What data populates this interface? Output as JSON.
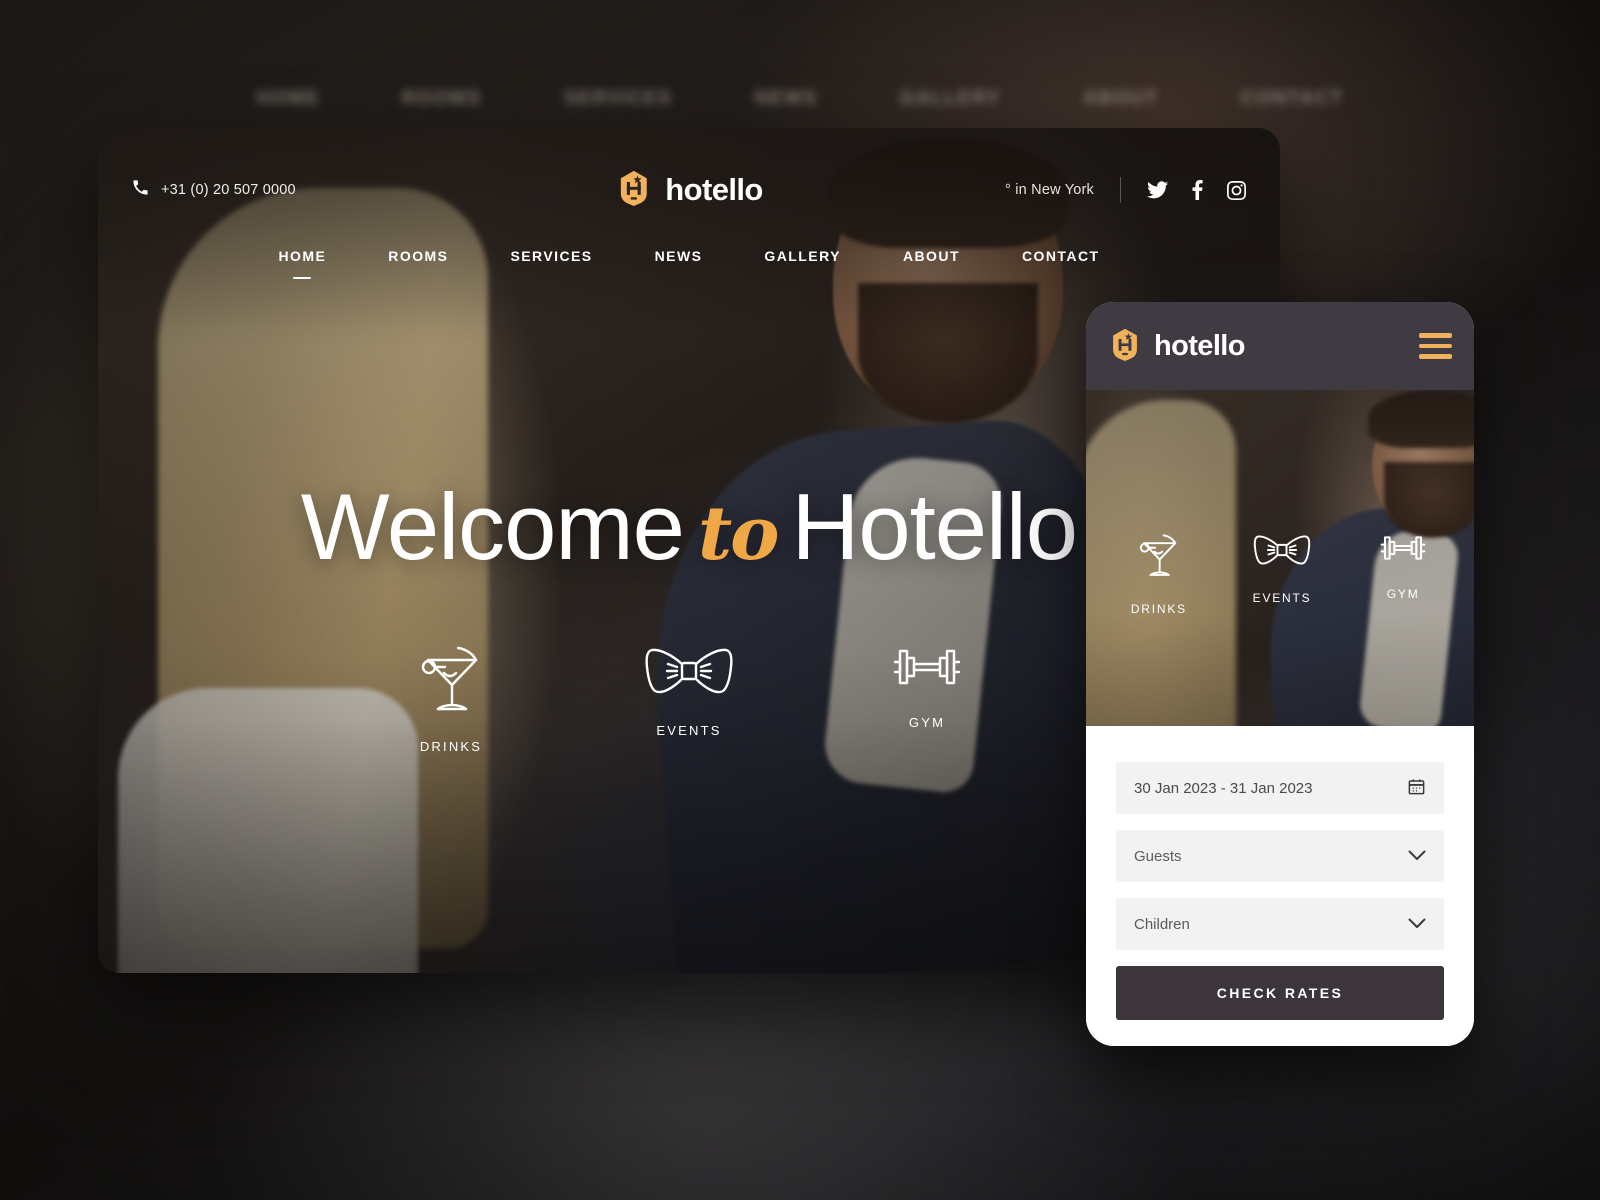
{
  "background": {
    "ghost_nav_items": [
      "HOME",
      "ROOMS",
      "SERVICES",
      "NEWS",
      "GALLERY",
      "ABOUT",
      "CONTACT"
    ]
  },
  "colors": {
    "brand_orange": "#f2b25c",
    "script_orange": "#f0a847",
    "page_background": "#2b2621",
    "phone_header": "#403a42",
    "button_dark": "#3c353c",
    "field_grey": "#f2f2f3"
  },
  "desktop": {
    "topbar": {
      "phone_icon": "phone-icon",
      "phone_number": "+31 (0) 20 507 0000",
      "weather": "° in New York",
      "socials": [
        {
          "name": "twitter-icon",
          "label": "Twitter"
        },
        {
          "name": "facebook-icon",
          "label": "Facebook"
        },
        {
          "name": "instagram-icon",
          "label": "Instagram"
        }
      ]
    },
    "logo": {
      "icon": "hotello-badge-icon",
      "text": "hotello"
    },
    "nav": [
      {
        "label": "HOME",
        "active": true
      },
      {
        "label": "ROOMS",
        "active": false
      },
      {
        "label": "SERVICES",
        "active": false
      },
      {
        "label": "NEWS",
        "active": false
      },
      {
        "label": "GALLERY",
        "active": false
      },
      {
        "label": "ABOUT",
        "active": false
      },
      {
        "label": "CONTACT",
        "active": false
      }
    ],
    "hero": {
      "title_part1": "Welcome",
      "title_script": "to",
      "title_part2": "Hotello"
    },
    "features": [
      {
        "icon": "cocktail-icon",
        "label": "DRINKS"
      },
      {
        "icon": "bowtie-icon",
        "label": "EVENTS"
      },
      {
        "icon": "dumbbell-icon",
        "label": "GYM"
      }
    ]
  },
  "mobile": {
    "logo": {
      "icon": "hotello-badge-icon",
      "text": "hotello"
    },
    "menu_icon": "hamburger-menu-icon",
    "features": [
      {
        "icon": "cocktail-icon",
        "label": "DRINKS"
      },
      {
        "icon": "bowtie-icon",
        "label": "EVENTS"
      },
      {
        "icon": "dumbbell-icon",
        "label": "GYM"
      }
    ],
    "booking": {
      "dates_value": "30 Jan 2023 - 31 Jan 2023",
      "dates_icon": "calendar-icon",
      "guests_placeholder": "Guests",
      "guests_icon": "chevron-down-icon",
      "children_placeholder": "Children",
      "children_icon": "chevron-down-icon",
      "submit_label": "CHECK RATES"
    }
  }
}
